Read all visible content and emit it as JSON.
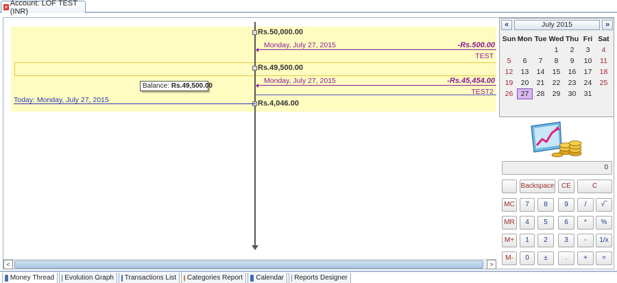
{
  "document_tab": {
    "label": "Account: LOF TEST (INR)"
  },
  "thread": {
    "balances": [
      "Rs.50,000.00",
      "Rs.49,500.00",
      "Rs.4,046.00"
    ],
    "transactions": [
      {
        "date": "Monday, July 27, 2015",
        "amount": "-Rs.500.00",
        "name": "TEST"
      },
      {
        "date": "Monday, July 27, 2015",
        "amount": "-Rs.45,454.00",
        "name": "TEST2"
      }
    ],
    "today_label": "Today: Monday, July 27, 2015",
    "tooltip": {
      "prefix": "Balance:",
      "value": "Rs.49,500.00"
    }
  },
  "scrollbar": {
    "left_arrow": "<",
    "right_arrow": ">"
  },
  "calendar": {
    "prev": "«",
    "next": "»",
    "title": "July 2015",
    "days_of_week": [
      "Sun",
      "Mon",
      "Tue",
      "Wed",
      "Thu",
      "Fri",
      "Sat"
    ],
    "weeks": [
      [
        "",
        "",
        "",
        "1",
        "2",
        "3",
        "4"
      ],
      [
        "5",
        "6",
        "7",
        "8",
        "9",
        "10",
        "11"
      ],
      [
        "12",
        "13",
        "14",
        "15",
        "16",
        "17",
        "18"
      ],
      [
        "19",
        "20",
        "21",
        "22",
        "23",
        "24",
        "25"
      ],
      [
        "26",
        "27",
        "28",
        "29",
        "30",
        "31",
        ""
      ]
    ],
    "selected_day": "27"
  },
  "calculator": {
    "display": "0",
    "row1": [
      "",
      "Backspace",
      "CE",
      "C"
    ],
    "keys": [
      [
        "MC",
        "7",
        "8",
        "9",
        "/",
        "√‾"
      ],
      [
        "MR",
        "4",
        "5",
        "6",
        "*",
        "%"
      ],
      [
        "M+",
        "1",
        "2",
        "3",
        "-",
        "1/x"
      ],
      [
        "M-",
        "0",
        "±",
        ".",
        "+",
        "="
      ]
    ]
  },
  "bottom_tabs": [
    {
      "label": "Money Thread",
      "icon": "thread-icon"
    },
    {
      "label": "Evolution Graph",
      "icon": "graph-icon"
    },
    {
      "label": "Transactions List",
      "icon": "list-icon"
    },
    {
      "label": "Categories Report",
      "icon": "pie-icon"
    },
    {
      "label": "Calendar",
      "icon": "calendar-icon"
    },
    {
      "label": "Reports Designer",
      "icon": "designer-icon"
    }
  ],
  "colors": {
    "band": "#fefcc0",
    "transaction": "#8a1a9c",
    "today": "#2a37b8",
    "weekend": "#a4242e",
    "selected_day": "#d9b8ee"
  }
}
